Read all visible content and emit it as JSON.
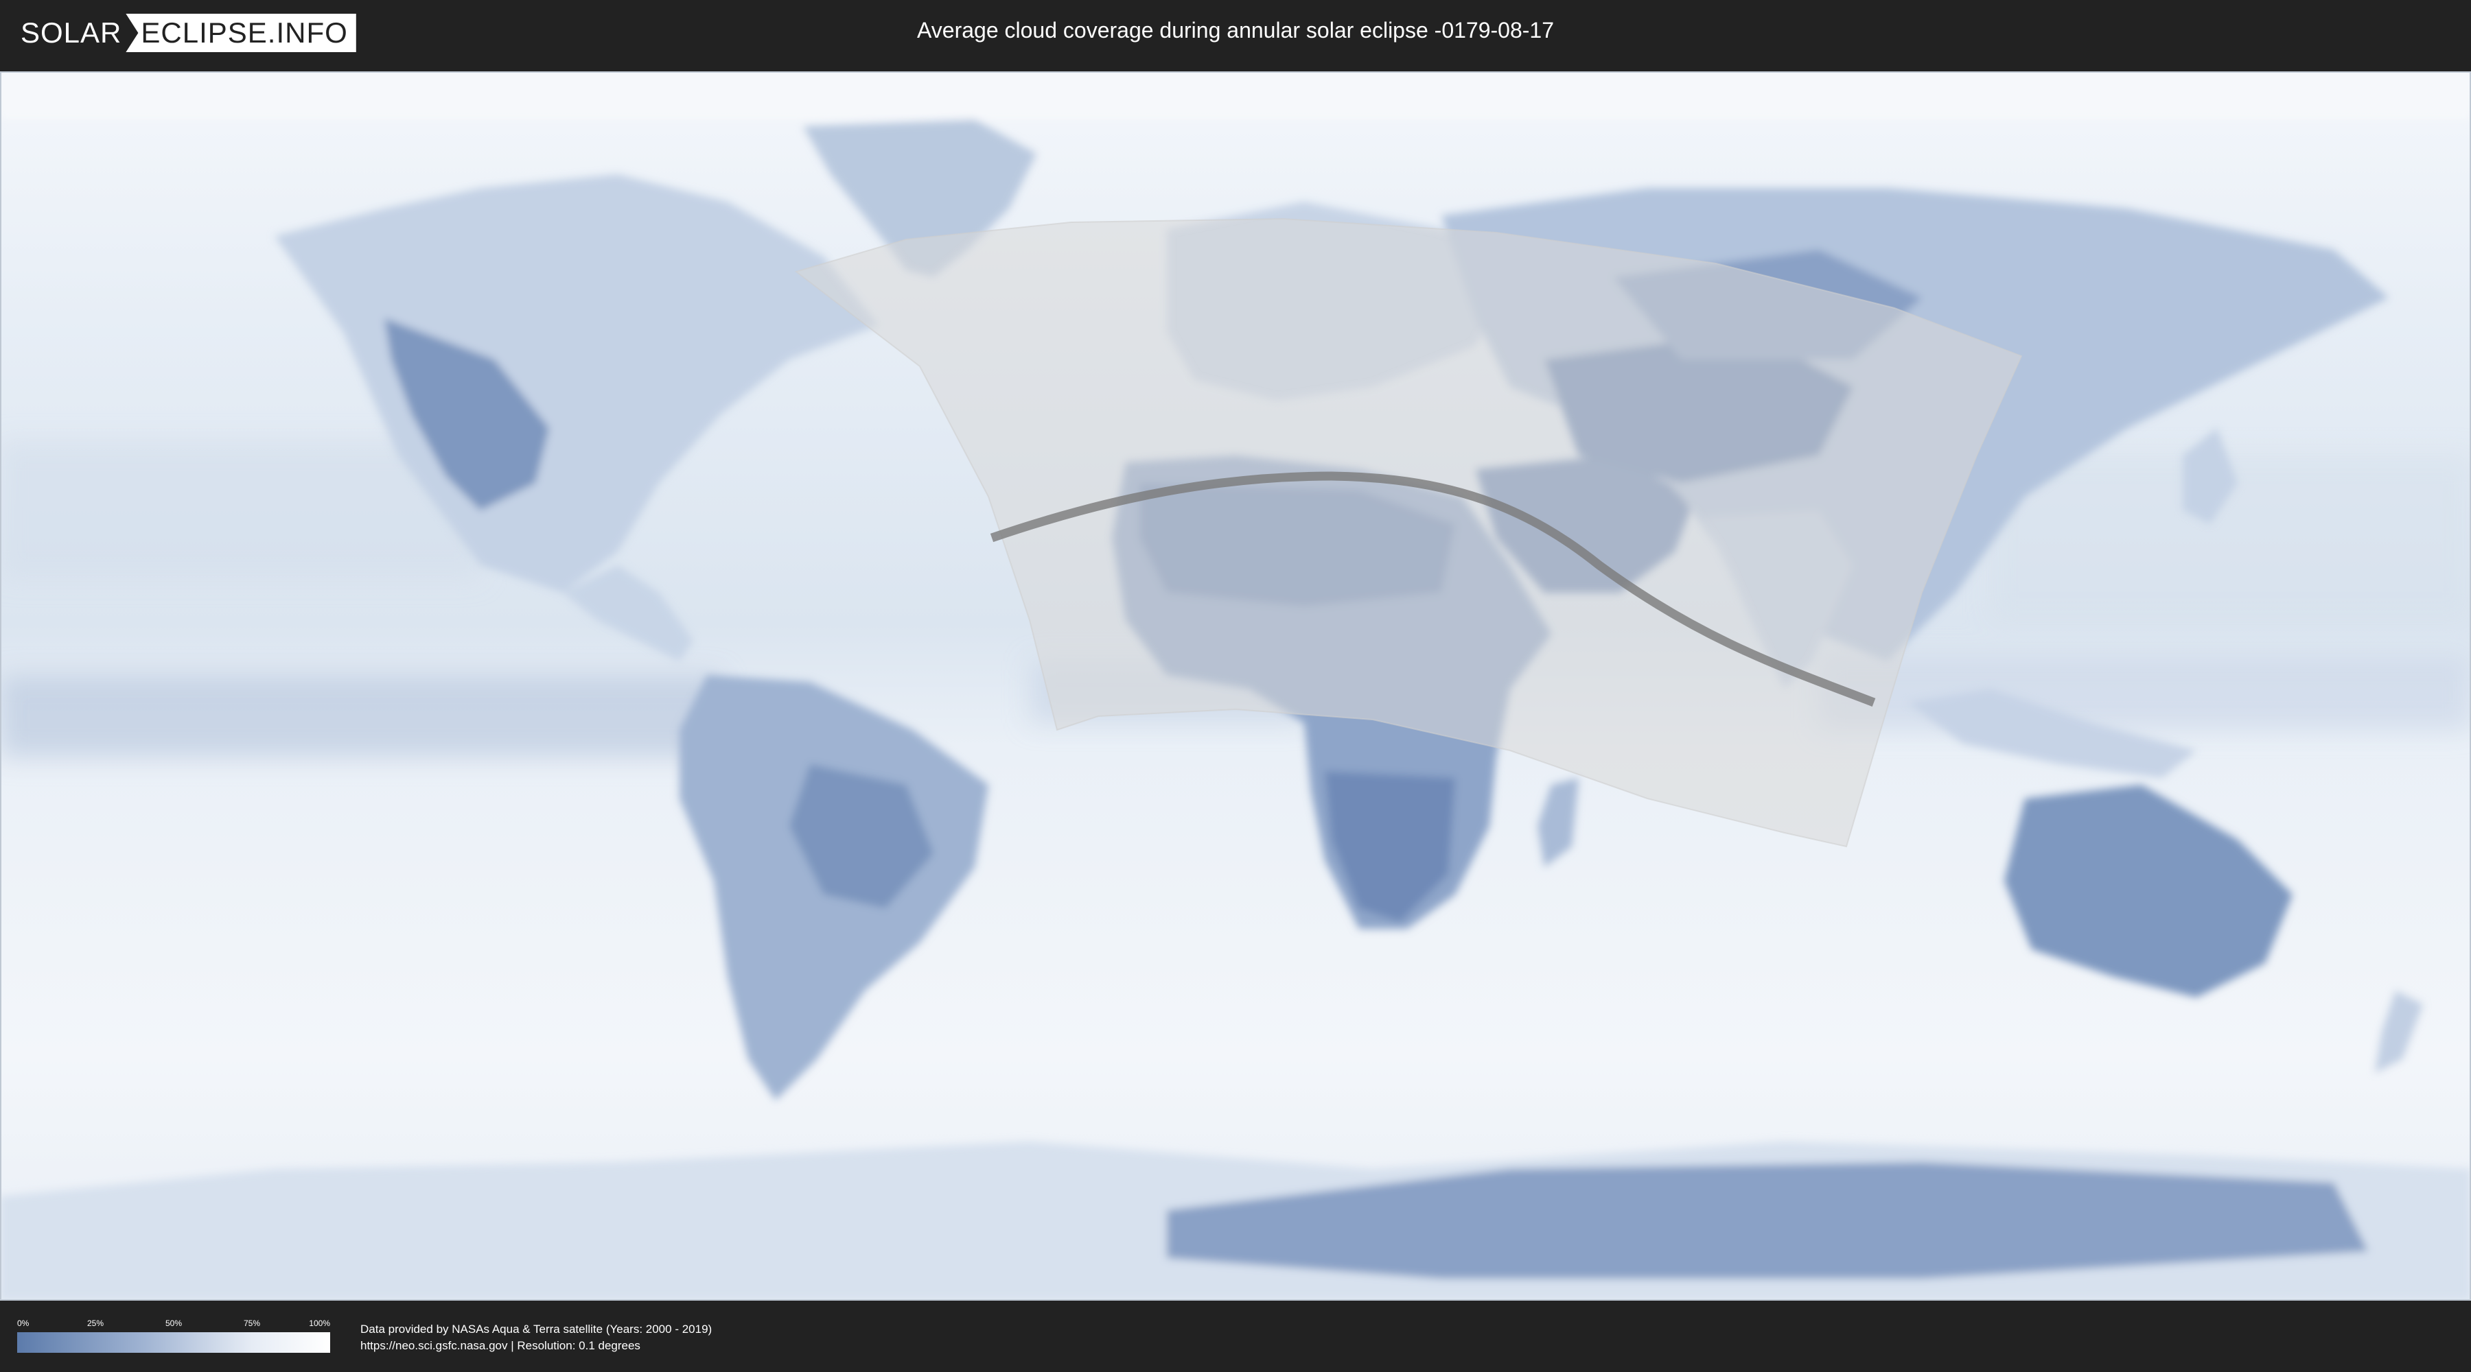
{
  "header": {
    "logo_left": "SOLAR",
    "logo_right": "ECLIPSE.INFO",
    "title": "Average cloud coverage during annular solar eclipse -0179-08-17"
  },
  "map": {
    "projection": "equirectangular",
    "ocean_color": "#e4ecf5",
    "clear_sky_color": "#5c7bab",
    "cloud_color": "#ffffff",
    "shadow_zone_color": "#d9d9d9",
    "central_line_color": "#7a7a7a"
  },
  "legend": {
    "ticks": [
      "0%",
      "25%",
      "50%",
      "75%",
      "100%"
    ],
    "gradient_from": "#5c7bab",
    "gradient_to": "#ffffff"
  },
  "credits": {
    "line1": "Data provided by NASAs Aqua & Terra satellite (Years: 2000 - 2019)",
    "line2": "https://neo.sci.gsfc.nasa.gov | Resolution: 0.1 degrees"
  }
}
